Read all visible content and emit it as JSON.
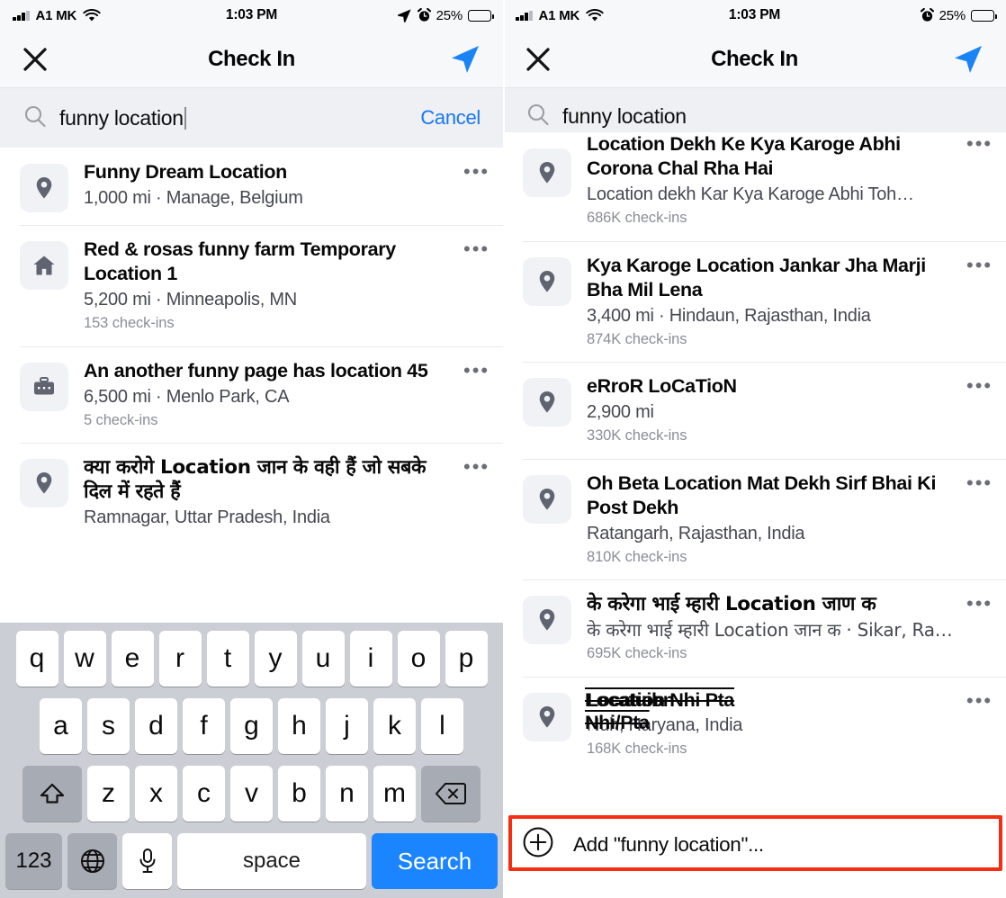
{
  "colors": {
    "accent_blue": "#1877f2",
    "key_blue": "#1b84ff",
    "highlight_red": "#f52d13",
    "tile_gray": "#f0f2f5",
    "chrome_gray": "#f7f8fa",
    "search_gray": "#eef0f4"
  },
  "left_panel": {
    "status_bar": {
      "carrier": "A1 MK",
      "time": "1:03 PM",
      "battery_percent": "25%",
      "icons": [
        "signal-bars-icon",
        "wifi-icon",
        "location-arrow-icon",
        "alarm-clock-icon",
        "battery-icon"
      ]
    },
    "nav": {
      "title": "Check In",
      "close_icon": "close-icon",
      "send_icon": "send-arrow-icon"
    },
    "search": {
      "value": "funny location",
      "placeholder": "Search",
      "cancel_label": "Cancel",
      "icon": "search-icon"
    },
    "results": [
      {
        "icon": "map-pin-icon",
        "title": "Funny Dream Location",
        "subtitle": "1,000 mi · Manage, Belgium",
        "meta": "",
        "menu": "•••"
      },
      {
        "icon": "home-icon",
        "title": "Red & rosas funny farm Temporary Location 1",
        "subtitle": "5,200 mi · Minneapolis, MN",
        "meta": "153 check-ins",
        "menu": "•••"
      },
      {
        "icon": "briefcase-icon",
        "title": "An another funny page has location 45",
        "subtitle": "6,500 mi · Menlo Park, CA",
        "meta": "5 check-ins",
        "menu": "•••"
      },
      {
        "icon": "map-pin-icon",
        "title": "क्या करोगे Location जान के  वही हैं  जो सबके दिल में रहते हैं",
        "subtitle": "Ramnagar, Uttar Pradesh, India",
        "meta": "",
        "menu": "•••"
      }
    ],
    "keyboard": {
      "row1": [
        "q",
        "w",
        "e",
        "r",
        "t",
        "y",
        "u",
        "i",
        "o",
        "p"
      ],
      "row2": [
        "a",
        "s",
        "d",
        "f",
        "g",
        "h",
        "j",
        "k",
        "l"
      ],
      "row3": [
        "z",
        "x",
        "c",
        "v",
        "b",
        "n",
        "m"
      ],
      "shift_icon": "shift-arrow-icon",
      "backspace_icon": "backspace-icon",
      "numbers_label": "123",
      "globe_icon": "globe-icon",
      "mic_icon": "microphone-icon",
      "space_label": "space",
      "search_label": "Search"
    }
  },
  "right_panel": {
    "status_bar": {
      "carrier": "A1 MK",
      "time": "1:03 PM",
      "battery_percent": "25%",
      "icons": [
        "signal-bars-icon",
        "wifi-icon",
        "alarm-clock-icon",
        "battery-icon"
      ]
    },
    "nav": {
      "title": "Check In",
      "close_icon": "close-icon",
      "send_icon": "send-arrow-icon"
    },
    "search": {
      "value": "funny location",
      "placeholder": "Search",
      "icon": "search-icon"
    },
    "results": [
      {
        "icon": "map-pin-icon",
        "title": "Location Dekh Ke Kya Karoge Abhi Corona Chal Rha Hai",
        "subtitle": "Location dekh Kar Kya Karoge Abhi Toh…",
        "meta": "686K check-ins",
        "menu": "•••"
      },
      {
        "icon": "map-pin-icon",
        "title": "Kya Karoge Location Jankar Jha Marji Bha Mil Lena",
        "subtitle": "3,400 mi · Hindaun, Rajasthan, India",
        "meta": "874K check-ins",
        "menu": "•••"
      },
      {
        "icon": "map-pin-icon",
        "title": "eRroR LoCaTioN",
        "subtitle": "2,900 mi",
        "meta": "330K check-ins",
        "menu": "•••"
      },
      {
        "icon": "map-pin-icon",
        "title": "Oh Beta Location Mat Dekh Sirf Bhai Ki Post Dekh",
        "subtitle": "Ratangarh, Rajasthan, India",
        "meta": "810K check-ins",
        "menu": "•••"
      },
      {
        "icon": "map-pin-icon",
        "title": "के करेगा भाई म्हारी Location जाण क",
        "subtitle": "के करेगा भाई म्हारी Location जान क · Sikar, Ra…",
        "meta": "695K check-ins",
        "menu": "•••"
      },
      {
        "icon": "map-pin-icon",
        "title": "Location Nhi Pta",
        "title_overlay": "Locatuibn Nhi/Pta",
        "subtitle": "Nuh, Haryana, India",
        "meta": "168K check-ins",
        "menu": "•••"
      }
    ],
    "add_row": {
      "label": "Add \"funny location\"...",
      "icon": "plus-circle-icon",
      "highlighted": true
    }
  }
}
